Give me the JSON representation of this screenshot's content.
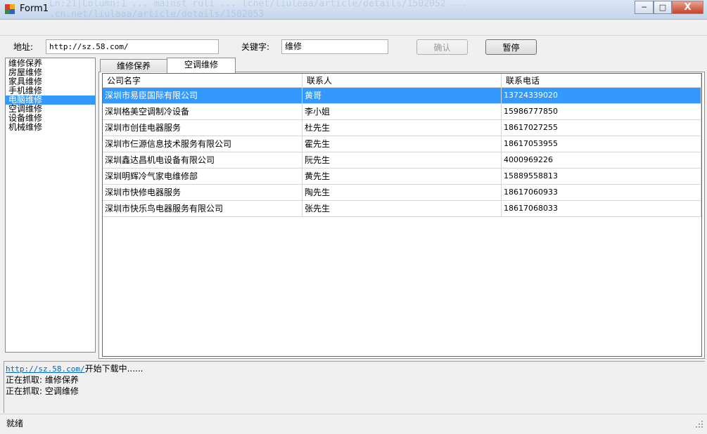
{
  "window": {
    "title": "Form1",
    "controls": {
      "minimize": "─",
      "maximize": "□",
      "close": "X"
    },
    "icon": "app-icon"
  },
  "address_bar": {
    "address_label": "地址:",
    "address_value": "http://sz.58.com/",
    "keyword_label": "关键字:",
    "keyword_value": "维修",
    "confirm_label": "确认",
    "pause_label": "暂停"
  },
  "categories": [
    {
      "label": "维修保养"
    },
    {
      "label": "房屋维修"
    },
    {
      "label": "家具维修"
    },
    {
      "label": "手机维修"
    },
    {
      "label": "电脑维修",
      "selected": true
    },
    {
      "label": "空调维修"
    },
    {
      "label": "设备维修"
    },
    {
      "label": "机械维修"
    }
  ],
  "tabs": [
    {
      "label": "维修保养"
    },
    {
      "label": "空调维修",
      "active": true
    }
  ],
  "grid": {
    "columns": [
      "公司名字",
      "联系人",
      "联系电话"
    ],
    "rows": [
      {
        "company": "深圳市易臣国际有限公司",
        "contact": "黄哥",
        "phone": "13724339020",
        "selected": true
      },
      {
        "company": "深圳格美空调制冷设备",
        "contact": "李小姐",
        "phone": "15986777850"
      },
      {
        "company": "深圳市创佳电器服务",
        "contact": "杜先生",
        "phone": "18617027255"
      },
      {
        "company": "深圳市仨源信息技术服务有限公司",
        "contact": "霍先生",
        "phone": "18617053955"
      },
      {
        "company": "深圳鑫达昌机电设备有限公司",
        "contact": "阮先生",
        "phone": "4000969226"
      },
      {
        "company": "深圳明辉冷气家电维修部",
        "contact": "黄先生",
        "phone": "15889558813"
      },
      {
        "company": "深圳市快修电器服务",
        "contact": "陶先生",
        "phone": "18617060933"
      },
      {
        "company": "深圳市快乐鸟电器服务有限公司",
        "contact": "张先生",
        "phone": "18617068033"
      }
    ]
  },
  "log": {
    "link": "http://sz.58.com/",
    "line1_suffix": "开始下载中......",
    "line2": "正在抓取: 维修保养",
    "line3": "正在抓取: 空调维修"
  },
  "status": {
    "text": "就绪"
  },
  "colors": {
    "selection": "#3399ff",
    "link": "#0066cc",
    "close_button": "#c4432a"
  }
}
